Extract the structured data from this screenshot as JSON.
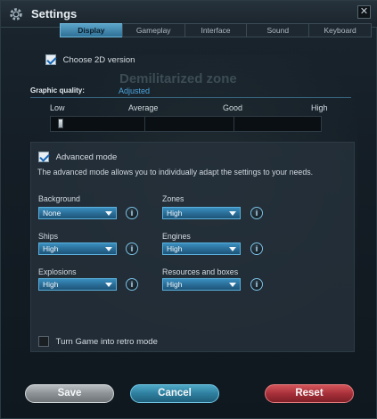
{
  "window": {
    "title": "Settings"
  },
  "tabs": [
    {
      "label": "Display",
      "active": true
    },
    {
      "label": "Gameplay",
      "active": false
    },
    {
      "label": "Interface",
      "active": false
    },
    {
      "label": "Sound",
      "active": false
    },
    {
      "label": "Keyboard",
      "active": false
    }
  ],
  "display": {
    "choose_2d": {
      "label": "Choose 2D version",
      "checked": true
    },
    "background_zone_name": "Demilitarized zone",
    "graphic_quality": {
      "label": "Graphic quality:",
      "value": "Adjusted",
      "levels": [
        "Low",
        "Average",
        "Good",
        "High"
      ],
      "slider_position": 0.02
    },
    "advanced": {
      "label": "Advanced mode",
      "checked": true,
      "description": "The advanced mode allows you to individually adapt the settings to your needs.",
      "fields": {
        "background": {
          "label": "Background",
          "value": "None"
        },
        "zones": {
          "label": "Zones",
          "value": "High"
        },
        "ships": {
          "label": "Ships",
          "value": "High"
        },
        "engines": {
          "label": "Engines",
          "value": "High"
        },
        "explosions": {
          "label": "Explosions",
          "value": "High"
        },
        "resources": {
          "label": "Resources and boxes",
          "value": "High"
        }
      },
      "info_symbol": "i"
    },
    "retro": {
      "label": "Turn Game into retro mode",
      "checked": false
    }
  },
  "buttons": {
    "save": "Save",
    "cancel": "Cancel",
    "reset": "Reset"
  },
  "colors": {
    "accent": "#4da6e0",
    "tab_active": "#5ba4c8",
    "reset": "#a8303a",
    "cancel": "#2e7f9f"
  }
}
